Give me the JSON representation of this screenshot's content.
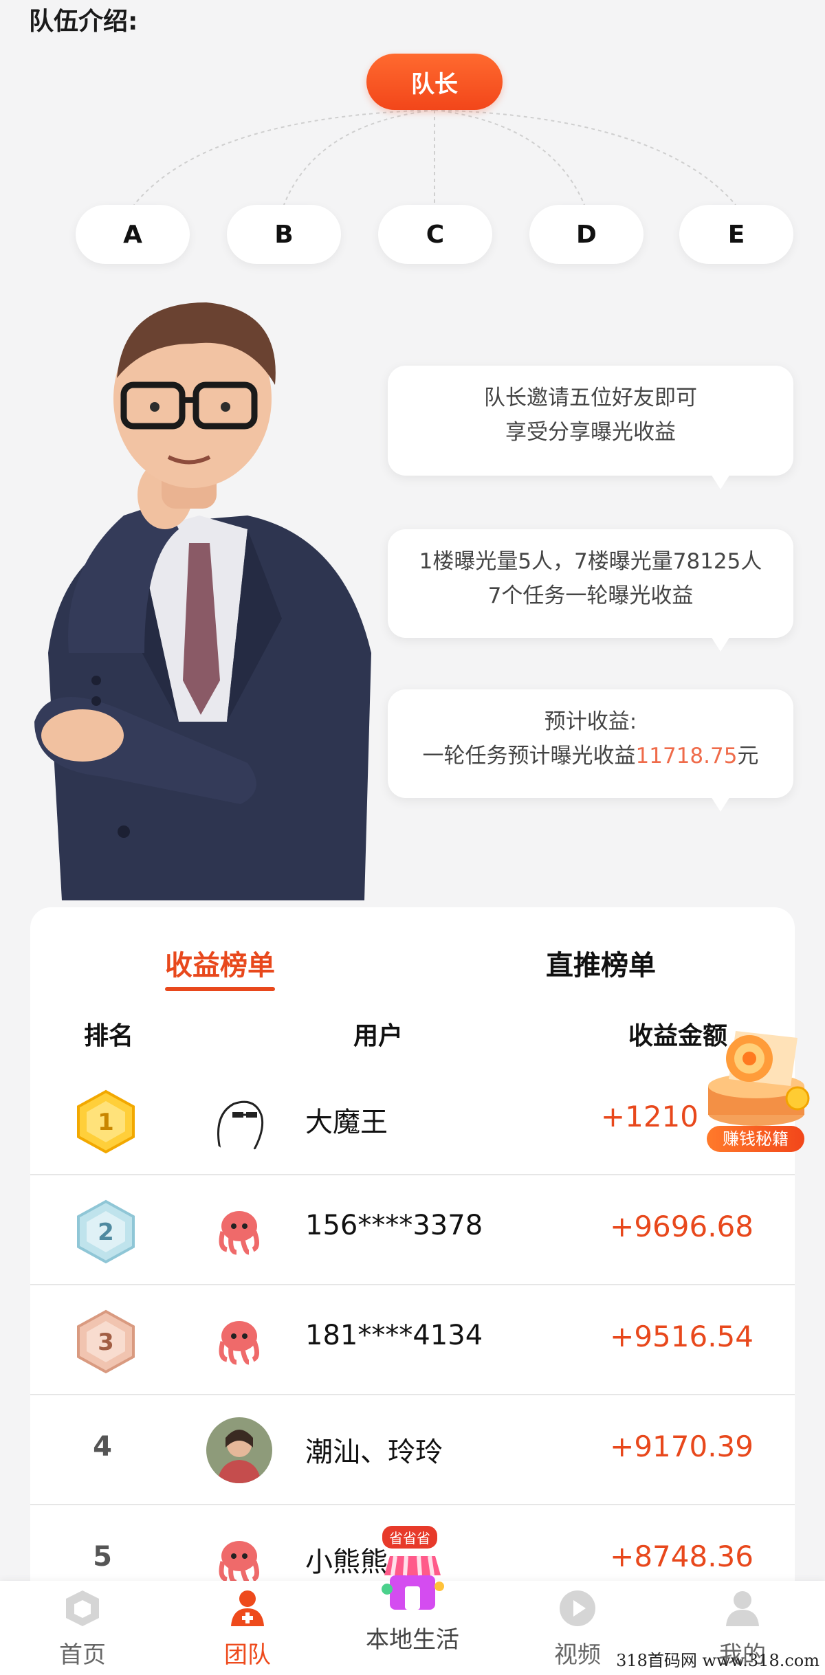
{
  "section_title": "队伍介绍:",
  "tree": {
    "leader": "队长",
    "members": [
      "A",
      "B",
      "C",
      "D",
      "E"
    ]
  },
  "bubbles": [
    {
      "line1": "队长邀请五位好友即可",
      "line2": "享受分享曝光收益"
    },
    {
      "line1": "1楼曝光量5人，7楼曝光量78125人",
      "line2": "7个任务一轮曝光收益"
    },
    {
      "line1": "预计收益:",
      "line2_prefix": "一轮任务预计曝光收益",
      "line2_value": "11718.75",
      "line2_suffix": "元"
    }
  ],
  "ranking": {
    "tabs": [
      "收益榜单",
      "直推榜单"
    ],
    "active_tab": "收益榜单",
    "headers": {
      "rank": "排名",
      "user": "用户",
      "amount": "收益金额"
    },
    "rows": [
      {
        "rank": "1",
        "name": "大魔王",
        "amount": "+1210"
      },
      {
        "rank": "2",
        "name": "156****3378",
        "amount": "+9696.68"
      },
      {
        "rank": "3",
        "name": "181****4134",
        "amount": "+9516.54"
      },
      {
        "rank": "4",
        "name": "潮汕、玲玲",
        "amount": "+9170.39"
      },
      {
        "rank": "5",
        "name": "小熊熊",
        "amount": "+8748.36"
      }
    ]
  },
  "float_button": {
    "label": "赚钱秘籍"
  },
  "nav": {
    "items": [
      "首页",
      "团队",
      "本地生活",
      "视频",
      "我的"
    ],
    "active": "团队",
    "promo_badge": "省省省"
  },
  "watermark": "318首码网 www.318.com",
  "colors": {
    "accent": "#e8481c",
    "highlight": "#ef6b4a"
  }
}
